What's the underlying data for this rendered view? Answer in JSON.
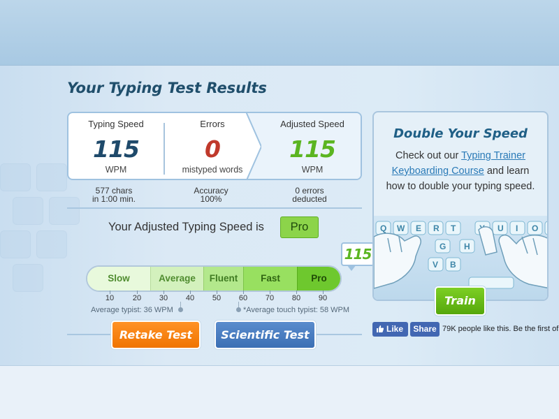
{
  "page": {
    "title": "Your Typing Test Results"
  },
  "stats": {
    "typing_speed": {
      "label": "Typing Speed",
      "value": "115",
      "unit": "WPM"
    },
    "errors": {
      "label": "Errors",
      "value": "0",
      "unit": "mistyped words"
    },
    "adjusted_speed": {
      "label": "Adjusted Speed",
      "value": "115",
      "unit": "WPM"
    }
  },
  "sub_stats": {
    "chars_line1": "577 chars",
    "chars_line2": "in 1:00 min.",
    "accuracy_line1": "Accuracy",
    "accuracy_line2": "100%",
    "deducted_line1": "0 errors",
    "deducted_line2": "deducted"
  },
  "level": {
    "text": "Your Adjusted Typing Speed is",
    "badge": "Pro",
    "marker_value": "115"
  },
  "scale": {
    "segments": [
      "Slow",
      "Average",
      "Fluent",
      "Fast",
      "Pro"
    ],
    "ticks": [
      "10",
      "20",
      "30",
      "40",
      "50",
      "60",
      "70",
      "80",
      "90"
    ],
    "average_typist": "Average typist: 36 WPM",
    "average_touch_typist": "*Average touch typist: 58 WPM"
  },
  "buttons": {
    "retake": "Retake Test",
    "scientific": "Scientific Test",
    "train": "Train"
  },
  "promo": {
    "title": "Double Your Speed",
    "text_before": "Check out our ",
    "link_text": "Typing Trainer Keyboarding Course",
    "text_after": " and learn how to double your typing speed."
  },
  "facebook": {
    "like": "Like",
    "share": "Share",
    "text": "79K people like this. Be the first of"
  },
  "colors": {
    "speed": "#1f4a6b",
    "errors": "#c0392b",
    "adjusted": "#5bb521",
    "retake_button": "#f07b0a",
    "scientific_button": "#4a7fc3",
    "train_button": "#6cbf1a",
    "facebook": "#4267b2"
  }
}
